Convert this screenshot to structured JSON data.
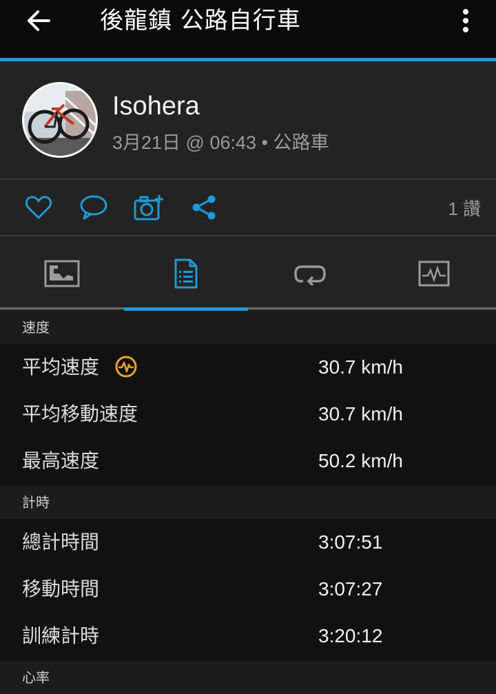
{
  "appbar": {
    "title": "後龍鎮 公路自行車",
    "back_icon": "arrow-left-icon",
    "menu_icon": "more-vert-icon"
  },
  "profile": {
    "username": "Isohera",
    "meta": "3月21日 @ 06:43 • 公路車"
  },
  "actions": {
    "like_icon": "heart-icon",
    "comment_icon": "comment-icon",
    "photo_icon": "add-photo-icon",
    "share_icon": "share-icon",
    "likes_text": "1 讚"
  },
  "tabs": [
    {
      "name": "overview-tab",
      "icon": "map-card-icon"
    },
    {
      "name": "stats-tab",
      "icon": "document-list-icon",
      "active": true
    },
    {
      "name": "laps-tab",
      "icon": "loop-icon"
    },
    {
      "name": "charts-tab",
      "icon": "chart-card-icon"
    }
  ],
  "sections": {
    "speed": {
      "header": "速度",
      "rows": [
        {
          "label": "平均速度",
          "value": "30.7 km/h"
        },
        {
          "label": "平均移動速度",
          "value": "30.7 km/h"
        },
        {
          "label": "最高速度",
          "value": "50.2 km/h"
        }
      ]
    },
    "timing": {
      "header": "計時",
      "rows": [
        {
          "label": "總計時間",
          "value": "3:07:51"
        },
        {
          "label": "移動時間",
          "value": "3:07:27"
        },
        {
          "label": "訓練計時",
          "value": "3:20:12"
        }
      ]
    },
    "heartrate": {
      "header": "心率"
    }
  },
  "colors": {
    "accent": "#1e9ad6",
    "badge": "#f0a030"
  }
}
